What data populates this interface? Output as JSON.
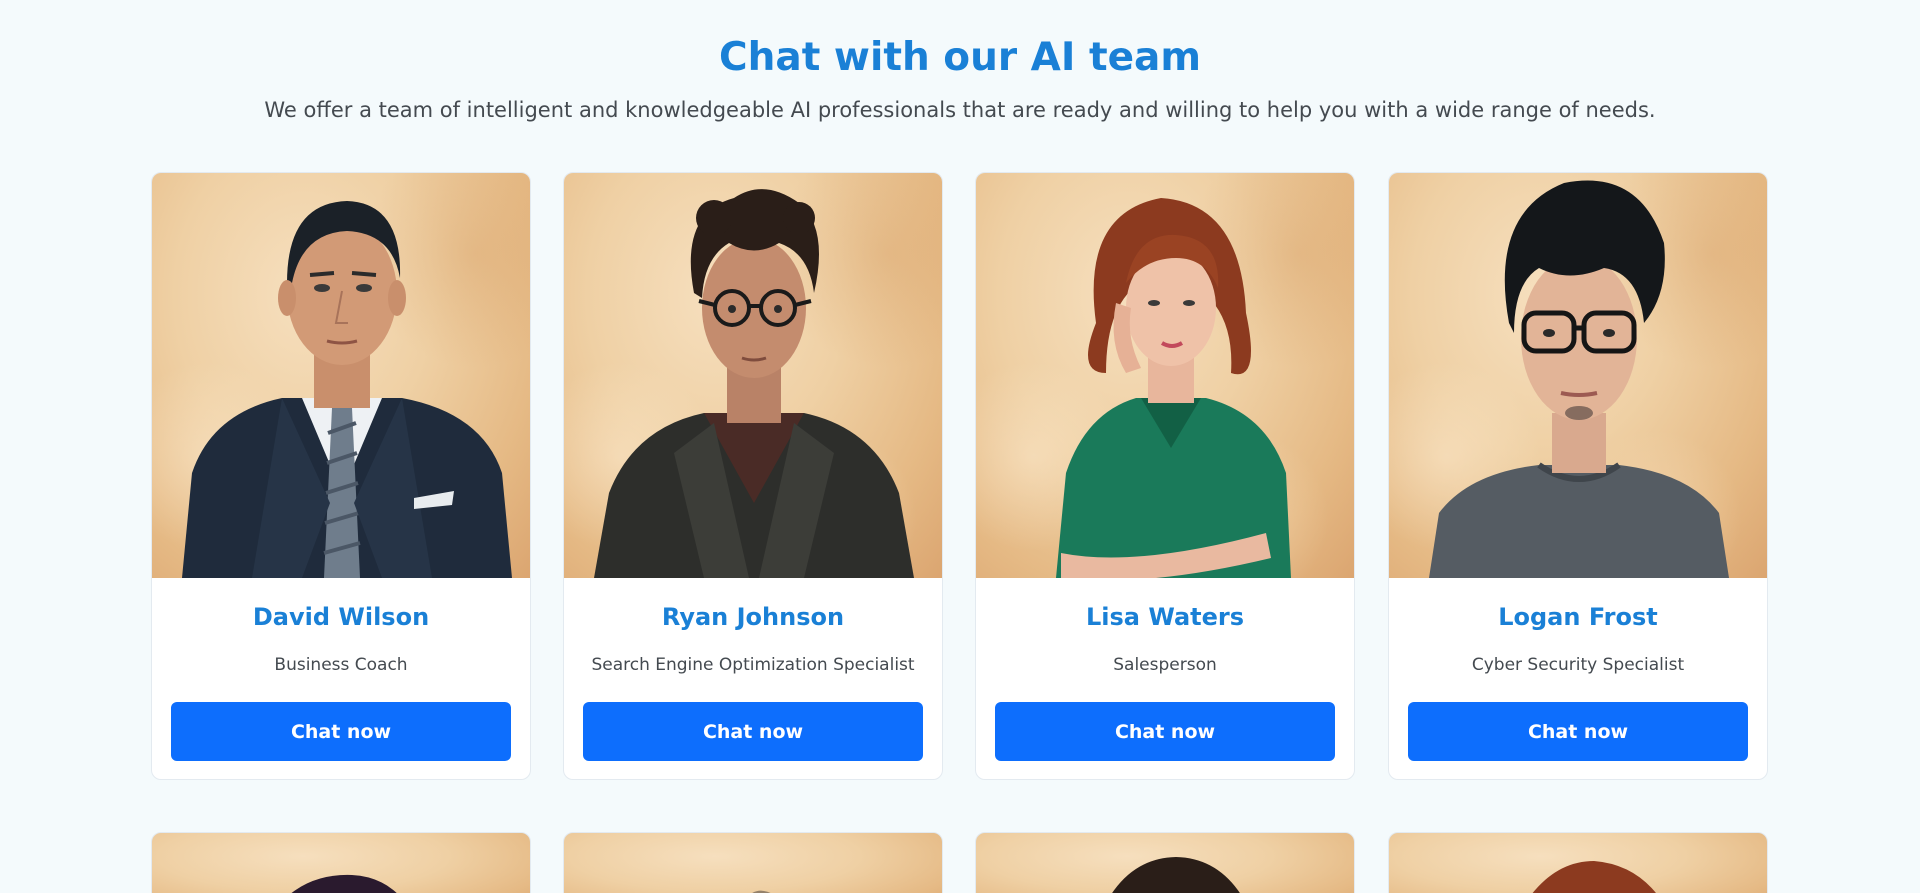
{
  "header": {
    "title": "Chat with our AI team",
    "subtitle": "We offer a team of intelligent and knowledgeable AI professionals that are ready and willing to help you with a wide range of needs."
  },
  "team": [
    {
      "name": "David Wilson",
      "role": "Business Coach",
      "button": "Chat now",
      "portrait": "businessman-in-suit-portrait"
    },
    {
      "name": "Ryan Johnson",
      "role": "Search Engine Optimization Specialist",
      "button": "Chat now",
      "portrait": "young-man-with-glasses-portrait"
    },
    {
      "name": "Lisa Waters",
      "role": "Salesperson",
      "button": "Chat now",
      "portrait": "red-haired-woman-in-green-blouse-portrait"
    },
    {
      "name": "Logan Frost",
      "role": "Cyber Security Specialist",
      "button": "Chat now",
      "portrait": "young-man-with-dark-glasses-portrait"
    }
  ],
  "colors": {
    "background": "#f4fafc",
    "heading": "#1a80d6",
    "button": "#0d6efd",
    "text": "#444a50"
  }
}
